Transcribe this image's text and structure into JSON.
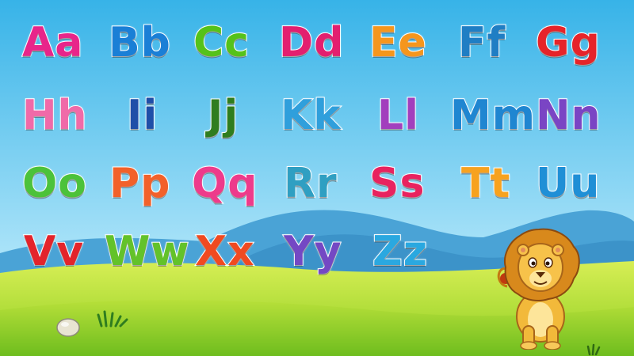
{
  "colors": {
    "sky_top": "#3bb6ea",
    "sky_bottom": "#bfe9fb",
    "hills": "#4aa6d8",
    "grass": "#a9d927",
    "grass_light": "#d9ee5a"
  },
  "letters": [
    {
      "text": "Aa",
      "color": "#e8258a"
    },
    {
      "text": "Bb",
      "color": "#1a7fd6"
    },
    {
      "text": "Cc",
      "color": "#55c21a"
    },
    {
      "text": "Dd",
      "color": "#e31f6f"
    },
    {
      "text": "Ee",
      "color": "#f5961d"
    },
    {
      "text": "Ff",
      "color": "#1f7ec4"
    },
    {
      "text": "Gg",
      "color": "#e6242a"
    },
    {
      "text": "Hh",
      "color": "#f06aa8"
    },
    {
      "text": "Ii",
      "color": "#1f4fa8"
    },
    {
      "text": "Jj",
      "color": "#2f7d1f"
    },
    {
      "text": "Kk",
      "color": "#2f9fdc"
    },
    {
      "text": "Ll",
      "color": "#a23fbd"
    },
    {
      "text": "Mm",
      "color": "#1f86d1"
    },
    {
      "text": "Nn",
      "color": "#7a45c4"
    },
    {
      "text": "Oo",
      "color": "#4cc23a"
    },
    {
      "text": "Pp",
      "color": "#f2612a"
    },
    {
      "text": "Qq",
      "color": "#ee3b8b"
    },
    {
      "text": "Rr",
      "color": "#2f9fc2"
    },
    {
      "text": "Ss",
      "color": "#e8235f"
    },
    {
      "text": "Tt",
      "color": "#f7a21f"
    },
    {
      "text": "Uu",
      "color": "#1f8fd6"
    },
    {
      "text": "Vv",
      "color": "#e3242b"
    },
    {
      "text": "Ww",
      "color": "#63c22a"
    },
    {
      "text": "Xx",
      "color": "#f04a21"
    },
    {
      "text": "Yy",
      "color": "#7448c4"
    },
    {
      "text": "Zz",
      "color": "#2aa8e0"
    }
  ],
  "illustrations": {
    "mascot": "lion",
    "props": [
      "rock",
      "grass-tuft"
    ]
  }
}
